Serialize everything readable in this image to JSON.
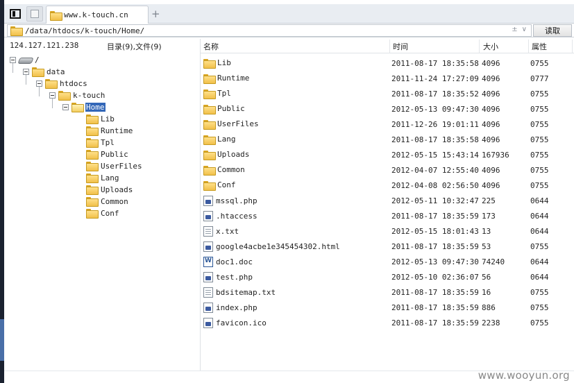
{
  "tab": {
    "title": "www.k-touch.cn"
  },
  "address": {
    "path": "/data/htdocs/k-touch/Home/",
    "tool1": "±",
    "tool2": "∨",
    "read_button": "读取"
  },
  "info": {
    "ip": "124.127.121.238",
    "counts": "目录(9),文件(9)"
  },
  "tree": {
    "root": "/",
    "data": "data",
    "htdocs": "htdocs",
    "ktouch": "k-touch",
    "home": "Home",
    "children": [
      "Lib",
      "Runtime",
      "Tpl",
      "Public",
      "UserFiles",
      "Lang",
      "Uploads",
      "Common",
      "Conf"
    ]
  },
  "columns": {
    "name": "名称",
    "time": "时间",
    "size": "大小",
    "perm": "属性"
  },
  "files": [
    {
      "name": "Lib",
      "type": "folder",
      "time": "2011-08-17 18:35:58",
      "size": "4096",
      "perm": "0755"
    },
    {
      "name": "Runtime",
      "type": "folder",
      "time": "2011-11-24 17:27:09",
      "size": "4096",
      "perm": "0777"
    },
    {
      "name": "Tpl",
      "type": "folder",
      "time": "2011-08-17 18:35:52",
      "size": "4096",
      "perm": "0755"
    },
    {
      "name": "Public",
      "type": "folder",
      "time": "2012-05-13 09:47:30",
      "size": "4096",
      "perm": "0755"
    },
    {
      "name": "UserFiles",
      "type": "folder",
      "time": "2011-12-26 19:01:11",
      "size": "4096",
      "perm": "0755"
    },
    {
      "name": "Lang",
      "type": "folder",
      "time": "2011-08-17 18:35:58",
      "size": "4096",
      "perm": "0755"
    },
    {
      "name": "Uploads",
      "type": "folder",
      "time": "2012-05-15 15:43:14",
      "size": "167936",
      "perm": "0755"
    },
    {
      "name": "Common",
      "type": "folder",
      "time": "2012-04-07 12:55:40",
      "size": "4096",
      "perm": "0755"
    },
    {
      "name": "Conf",
      "type": "folder",
      "time": "2012-04-08 02:56:50",
      "size": "4096",
      "perm": "0755"
    },
    {
      "name": "mssql.php",
      "type": "php",
      "time": "2012-05-11 10:32:47",
      "size": "225",
      "perm": "0644"
    },
    {
      "name": ".htaccess",
      "type": "hta",
      "time": "2011-08-17 18:35:59",
      "size": "173",
      "perm": "0644"
    },
    {
      "name": "x.txt",
      "type": "txt",
      "time": "2012-05-15 18:01:43",
      "size": "13",
      "perm": "0644"
    },
    {
      "name": "google4acbe1e345454302.html",
      "type": "html",
      "time": "2011-08-17 18:35:59",
      "size": "53",
      "perm": "0755"
    },
    {
      "name": "doc1.doc",
      "type": "doc",
      "time": "2012-05-13 09:47:30",
      "size": "74240",
      "perm": "0644"
    },
    {
      "name": "test.php",
      "type": "php",
      "time": "2012-05-10 02:36:07",
      "size": "56",
      "perm": "0644"
    },
    {
      "name": "bdsitemap.txt",
      "type": "txt",
      "time": "2011-08-17 18:35:59",
      "size": "16",
      "perm": "0755"
    },
    {
      "name": "index.php",
      "type": "php",
      "time": "2011-08-17 18:35:59",
      "size": "886",
      "perm": "0755"
    },
    {
      "name": "favicon.ico",
      "type": "ico",
      "time": "2011-08-17 18:35:59",
      "size": "2238",
      "perm": "0755"
    }
  ],
  "watermark": "www.wooyun.org"
}
